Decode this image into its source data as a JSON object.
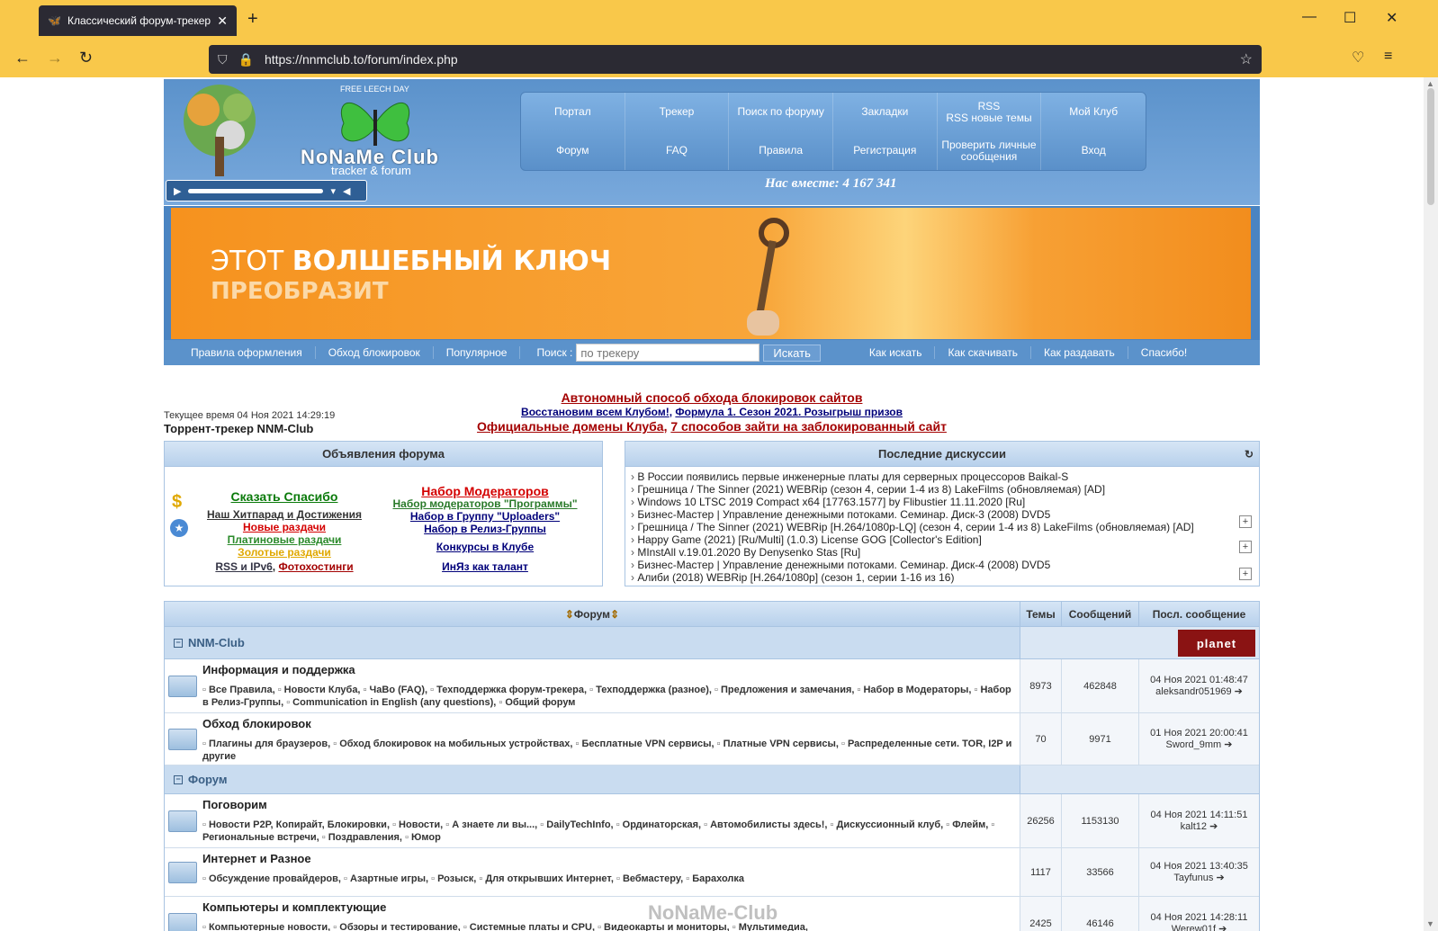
{
  "browser": {
    "tab_title": "Классический форум-трекер",
    "url": "https://nnmclub.to/forum/index.php"
  },
  "header": {
    "free_leech": "FREE LEECH DAY",
    "logo_name": "NoNaMe Club",
    "logo_sub": "tracker & forum",
    "together": "Нас вместе: 4 167 341",
    "menu": [
      {
        "label": "Портал",
        "name": "menu-portal"
      },
      {
        "label": "Трекер",
        "name": "menu-tracker"
      },
      {
        "label": "Поиск по форуму",
        "name": "menu-forum-search"
      },
      {
        "label": "Закладки",
        "name": "menu-bookmarks"
      },
      {
        "label": "RSS\nRSS новые темы",
        "name": "menu-rss"
      },
      {
        "label": "Мой Клуб",
        "name": "menu-my-club"
      },
      {
        "label": "Форум",
        "name": "menu-forum"
      },
      {
        "label": "FAQ",
        "name": "menu-faq"
      },
      {
        "label": "Правила",
        "name": "menu-rules"
      },
      {
        "label": "Регистрация",
        "name": "menu-register"
      },
      {
        "label": "Проверить личные сообщения",
        "name": "menu-messages"
      },
      {
        "label": "Вход",
        "name": "menu-login"
      }
    ]
  },
  "banner": {
    "line1_a": "ЭТОТ ",
    "line1_b": "ВОЛШЕБНЫЙ КЛЮЧ",
    "line2": "ПРЕОБРАЗИТ"
  },
  "linkbar": {
    "rules": "Правила оформления",
    "bypass": "Обход блокировок",
    "popular": "Популярное",
    "search_label": "Поиск :",
    "search_placeholder": "по трекеру",
    "search_button": "Искать",
    "how_search": "Как искать",
    "how_download": "Как скачивать",
    "how_seed": "Как раздавать",
    "thanks": "Спасибо!"
  },
  "notice": {
    "line1": "Автономный способ обхода блокировок сайтов",
    "line2a": "Восстановим всем Клубом!",
    "line2b": "Формула 1. Сезон 2021. Розыгрыш призов",
    "line3a": "Официальные домены Клуба",
    "line3b": "7 способов зайти на заблокированный сайт",
    "current_time": "Текущее время 04 Ноя 2021 14:29:19",
    "tracker": "Торрент-трекер NNM-Club"
  },
  "announcements": {
    "title": "Объявления форума",
    "left": {
      "say_thanks": "Сказать Спасибо",
      "hitparade": "Наш Хитпарад и Достижения",
      "new": "Новые раздачи",
      "platinum": "Платиновые раздачи",
      "gold": "Золотые раздачи",
      "rss": "RSS и IPv6",
      "photo": "Фотохостинги"
    },
    "right": {
      "moderators": "Набор Модераторов",
      "mod_programs": "Набор модераторов \"Программы\"",
      "uploaders": "Набор в Группу \"Uploaders\"",
      "release": "Набор в Релиз-Группы",
      "contests": "Конкурсы в Клубе",
      "inyaz": "ИнЯз как талант"
    }
  },
  "discussions": {
    "title": "Последние дискуссии",
    "items": [
      "В России появились первые инженерные платы для серверных процессоров Baikal-S",
      "Грешница / The Sinner (2021) WEBRip (сезон 4, серии 1-4 из 8) LakeFilms (обновляемая) [AD]",
      "Windows 10 LTSC 2019 Compact x64 [17763.1577] by Flibustier 11.11.2020 [Ru]",
      "Бизнес-Мастер | Управление денежными потоками. Семинар. Диск-3 (2008) DVD5",
      "Грешница / The Sinner (2021) WEBRip [H.264/1080p-LQ] (сезон 4, серии 1-4 из 8) LakeFilms (обновляемая) [AD]",
      "Happy Game (2021) [Ru/Multi] (1.0.3) License GOG [Collector's Edition]",
      "MInstAll v.19.01.2020 By Denysenko Stas [Ru]",
      "Бизнес-Мастер | Управление денежными потоками. Семинар. Диск-4 (2008) DVD5",
      "Алиби (2018) WEBRip [H.264/1080p] (сезон 1, серии 1-16 из 16)"
    ]
  },
  "forum": {
    "col_forum": "Форум",
    "col_topics": "Темы",
    "col_posts": "Сообщений",
    "col_last": "Посл. сообщение",
    "planet": "planet",
    "categories": [
      {
        "name": "NNM-Club",
        "rows": [
          {
            "title": "Информация и поддержка",
            "subs": [
              "Все Правила,",
              "Новости Клуба,",
              "ЧаВо (FAQ),",
              "Техподдержка форум-трекера,",
              "Техподдержка (разное),",
              "Предложения и замечания,",
              "Набор в Модераторы,",
              "Набор в Релиз-Группы,",
              "Communication in English (any questions),",
              "Общий форум"
            ],
            "topics": "8973",
            "posts": "462848",
            "last_date": "04 Ноя 2021 01:48:47",
            "last_user": "aleksandr051969"
          },
          {
            "title": "Обход блокировок",
            "subs": [
              "Плагины для браузеров,",
              "Обход блокировок на мобильных устройствах,",
              "Бесплатные VPN сервисы,",
              "Платные VPN сервисы,",
              "Распределенные сети. TOR, I2P и другие"
            ],
            "topics": "70",
            "posts": "9971",
            "last_date": "01 Ноя 2021 20:00:41",
            "last_user": "Sword_9mm"
          }
        ]
      },
      {
        "name": "Форум",
        "rows": [
          {
            "title": "Поговорим",
            "subs": [
              "Новости P2P, Копирайт, Блокировки,",
              "Новости,",
              "А знаете ли вы...,",
              "DailyTechInfo,",
              "Ординаторская,",
              "Автомобилисты здесь!,",
              "Дискуссионный клуб,",
              "Флейм,",
              "Региональные встречи,",
              "Поздравления,",
              "Юмор"
            ],
            "topics": "26256",
            "posts": "1153130",
            "last_date": "04 Ноя 2021 14:11:51",
            "last_user": "kalt12"
          },
          {
            "title": "Интернет и Разное",
            "subs": [
              "Обсуждение провайдеров,",
              "Азартные игры,",
              "Розыск,",
              "Для открывших Интернет,",
              "Вебмастеру,",
              "Барахолка"
            ],
            "topics": "1117",
            "posts": "33566",
            "last_date": "04 Ноя 2021 13:40:35",
            "last_user": "Tayfunus"
          },
          {
            "title": "Компьютеры и комплектующие",
            "subs": [
              "Компьютерные новости,",
              "Обзоры и тестирование,",
              "Системные платы и CPU,",
              "Видеокарты и мониторы,",
              "Мультимедиа,"
            ],
            "topics": "2425",
            "posts": "46146",
            "last_date": "04 Ноя 2021 14:28:11",
            "last_user": "Werew01f"
          }
        ]
      }
    ]
  },
  "watermark": "NoNaMe-Club"
}
